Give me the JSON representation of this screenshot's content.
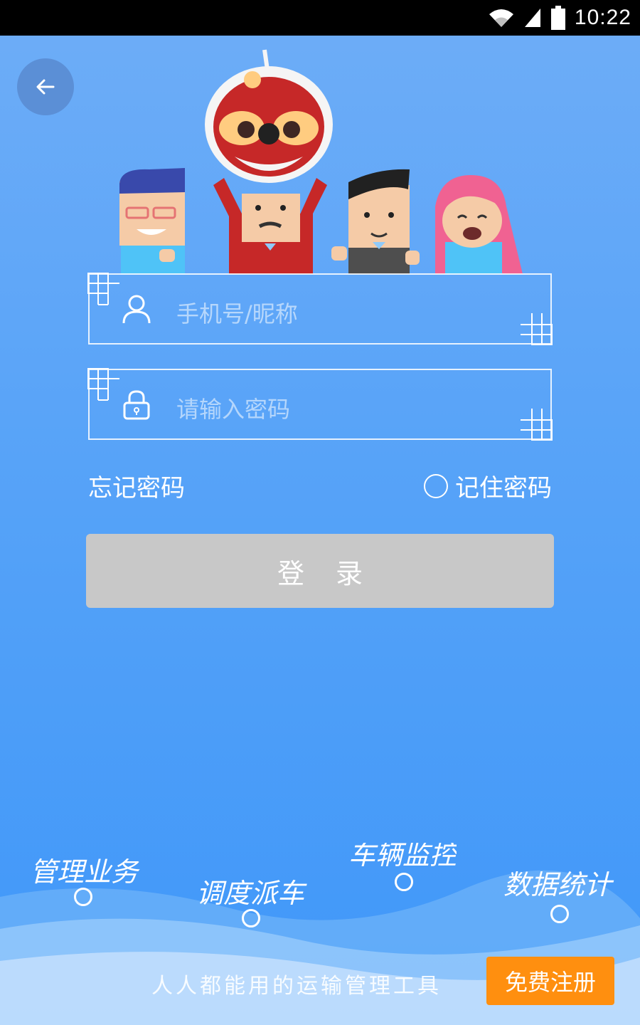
{
  "status": {
    "time": "10:22"
  },
  "form": {
    "username_placeholder": "手机号/昵称",
    "password_placeholder": "请输入密码",
    "forgot_label": "忘记密码",
    "remember_label": "记住密码",
    "login_label": "登录"
  },
  "features": [
    {
      "label": "管理业务"
    },
    {
      "label": "调度派车"
    },
    {
      "label": "车辆监控"
    },
    {
      "label": "数据统计"
    }
  ],
  "footer": {
    "tagline": "人人都能用的运输管理工具",
    "register_label": "免费注册"
  },
  "colors": {
    "background_top": "#6eadf7",
    "background_bottom": "#3f97f9",
    "login_button": "#c8c8c8",
    "register_button": "#ff8f0f"
  },
  "icons": [
    "back-arrow-icon",
    "user-icon",
    "lock-icon",
    "wifi-icon",
    "signal-icon",
    "battery-icon"
  ]
}
